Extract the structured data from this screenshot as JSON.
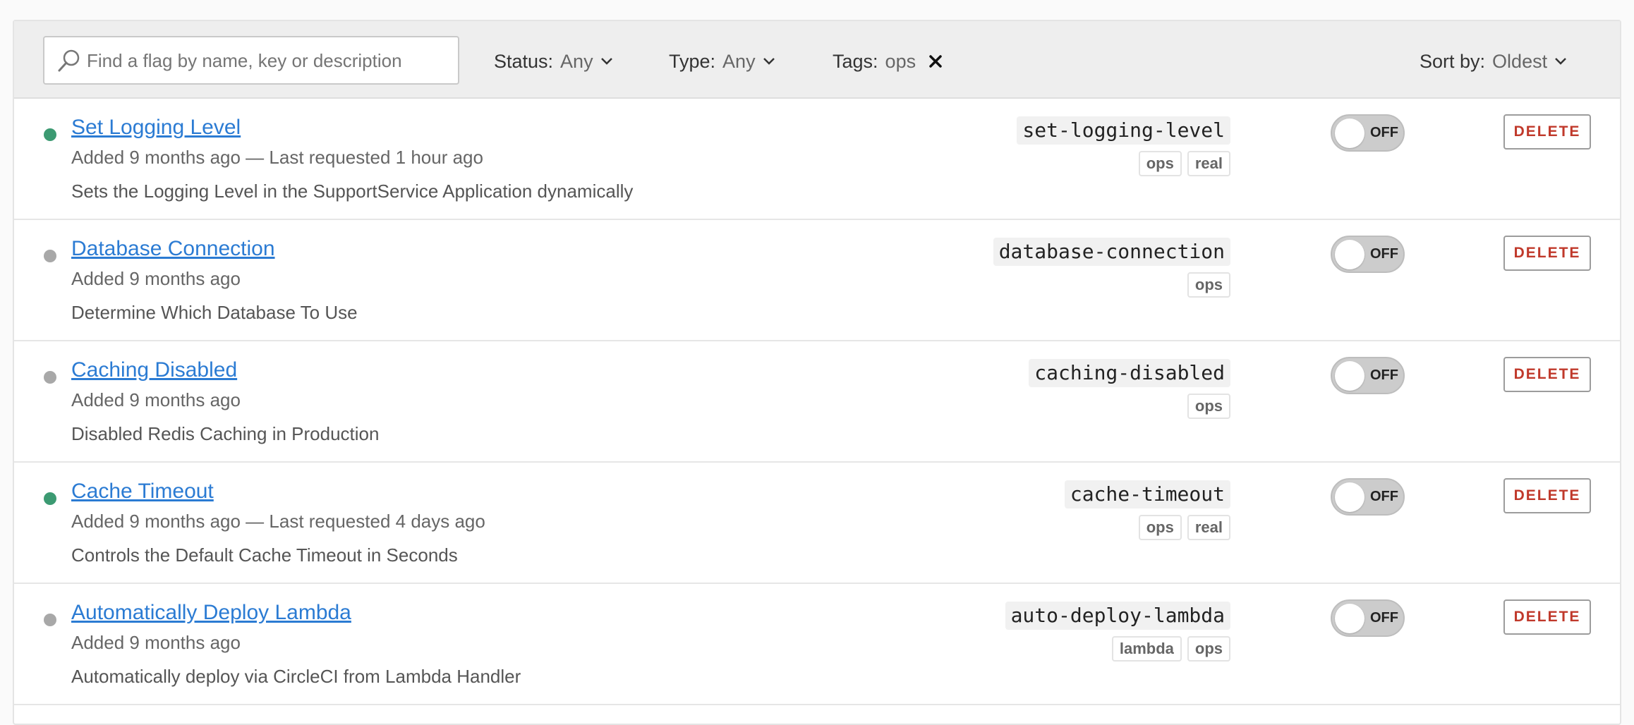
{
  "filters": {
    "search_placeholder": "Find a flag by name, key or description",
    "status": {
      "label": "Status:",
      "value": "Any"
    },
    "type": {
      "label": "Type:",
      "value": "Any"
    },
    "tags": {
      "label": "Tags:",
      "value": "ops"
    },
    "sort": {
      "label": "Sort by:",
      "value": "Oldest"
    }
  },
  "colors": {
    "active_dot": "#3c9a72",
    "inactive_dot": "#a8a8a8",
    "link": "#2b7bd3",
    "delete": "#c0392b"
  },
  "flags": [
    {
      "name": "Set Logging Level",
      "meta": "Added 9 months ago — Last requested 1 hour ago",
      "description": "Sets the Logging Level in the SupportService Application dynamically",
      "key": "set-logging-level",
      "tags": [
        "ops",
        "real"
      ],
      "active": true,
      "toggle_label": "OFF",
      "delete_label": "DELETE"
    },
    {
      "name": "Database Connection",
      "meta": "Added 9 months ago",
      "description": "Determine Which Database To Use",
      "key": "database-connection",
      "tags": [
        "ops"
      ],
      "active": false,
      "toggle_label": "OFF",
      "delete_label": "DELETE"
    },
    {
      "name": "Caching Disabled",
      "meta": "Added 9 months ago",
      "description": "Disabled Redis Caching in Production",
      "key": "caching-disabled",
      "tags": [
        "ops"
      ],
      "active": false,
      "toggle_label": "OFF",
      "delete_label": "DELETE"
    },
    {
      "name": "Cache Timeout",
      "meta": "Added 9 months ago — Last requested 4 days ago",
      "description": "Controls the Default Cache Timeout in Seconds",
      "key": "cache-timeout",
      "tags": [
        "ops",
        "real"
      ],
      "active": true,
      "toggle_label": "OFF",
      "delete_label": "DELETE"
    },
    {
      "name": "Automatically Deploy Lambda",
      "meta": "Added 9 months ago",
      "description": "Automatically deploy via CircleCI from Lambda Handler",
      "key": "auto-deploy-lambda",
      "tags": [
        "lambda",
        "ops"
      ],
      "active": false,
      "toggle_label": "OFF",
      "delete_label": "DELETE"
    }
  ]
}
